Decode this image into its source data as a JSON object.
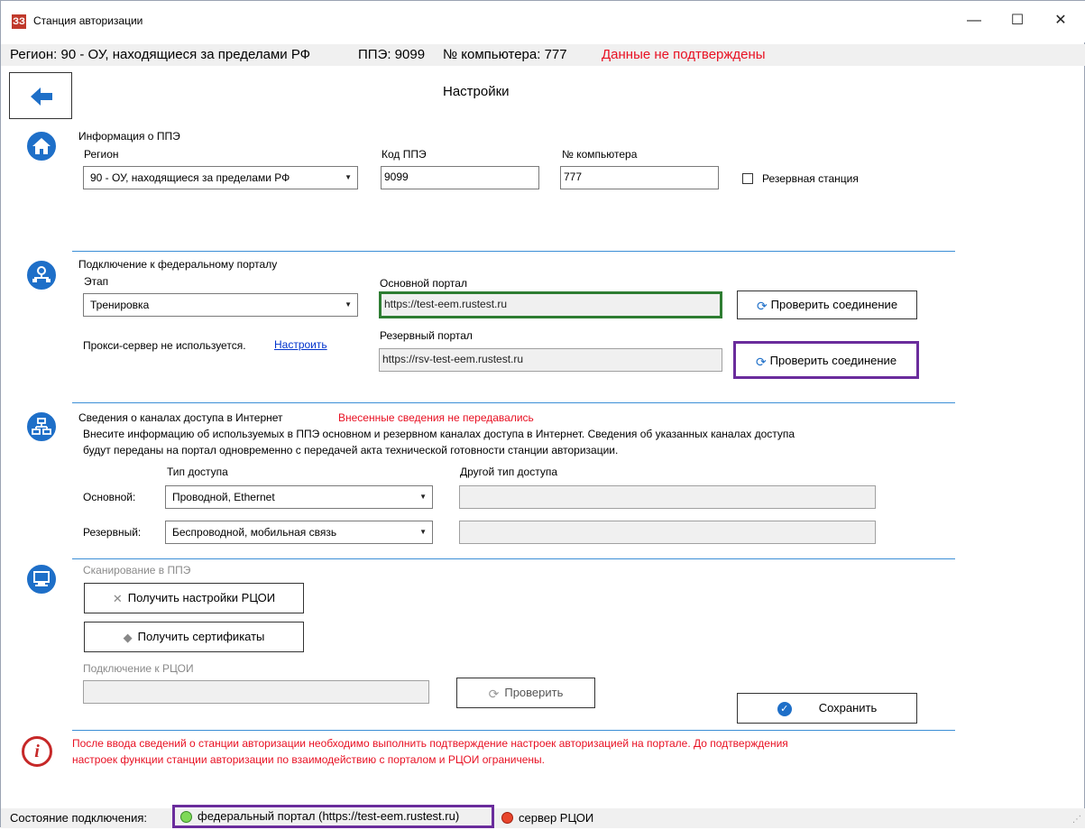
{
  "window": {
    "title": "Станция авторизации",
    "app_icon": "ЗЗ",
    "controls": {
      "minimize": "—",
      "maximize": "☐",
      "close": "✕"
    }
  },
  "infobar": {
    "region": "Регион: 90 - ОУ, находящиеся за пределами РФ",
    "ppe": "ППЭ: 9099",
    "computer": "№ компьютера: 777",
    "status": "Данные не подтверждены"
  },
  "page": {
    "title": "Настройки"
  },
  "ppe_info": {
    "heading": "Информация о ППЭ",
    "region_label": "Регион",
    "region_value": "90 - ОУ, находящиеся за пределами РФ",
    "code_label": "Код ППЭ",
    "code_value": "9099",
    "computer_label": "№ компьютера",
    "computer_value": "777",
    "reserve_label": "Резервная станция",
    "reserve_checked": false
  },
  "portal": {
    "heading": "Подключение к федеральному порталу",
    "stage_label": "Этап",
    "stage_value": "Тренировка",
    "proxy_text": "Прокси-сервер не используется.",
    "proxy_link": "Настроить",
    "main_label": "Основной портал",
    "main_url": "https://test-eem.rustest.ru",
    "reserve_label": "Резервный портал",
    "reserve_url": "https://rsv-test-eem.rustest.ru",
    "check_label_1": "Проверить соединение",
    "check_label_2": "Проверить соединение"
  },
  "channels": {
    "heading": "Сведения о каналах доступа в Интернет",
    "warning": "Внесенные сведения не передавались",
    "desc_line1": "Внесите информацию  об используемых в ППЭ основном и резервном каналах доступа в Интернет. Сведения об указанных каналах доступа",
    "desc_line2": "будут переданы на портал одновременно с передачей акта технической готовности станции авторизации.",
    "type_label": "Тип доступа",
    "other_label": "Другой тип доступа",
    "main_label": "Основной:",
    "main_value": "Проводной, Ethernet",
    "reserve_label": "Резервный:",
    "reserve_value": "Беспроводной, мобильная связь",
    "main_other": "",
    "reserve_other": ""
  },
  "scan": {
    "heading": "Сканирование в ППЭ",
    "get_settings": "Получить настройки РЦОИ",
    "get_certs": "Получить сертификаты",
    "rcoi_label": "Подключение к РЦОИ",
    "rcoi_value": "",
    "check": "Проверить",
    "save": "Сохранить"
  },
  "notice": {
    "line1": "После ввода сведений о станции авторизации необходимо выполнить подтверждение настроек авторизацией на портале. До подтверждения",
    "line2": "настроек функции станции авторизации по взаимодействию с порталом и РЦОИ ограничены."
  },
  "status": {
    "label": "Состояние подключения:",
    "portal": "федеральный портал (https://test-eem.rustest.ru)",
    "rcoi": "сервер РЦОИ",
    "portal_color": "#7ed957",
    "rcoi_color": "#e8452c"
  },
  "colors": {
    "accent": "#1e6fc8",
    "highlight": "#6a2c9c",
    "ok_border": "#2e7d32",
    "error": "#e81123"
  }
}
